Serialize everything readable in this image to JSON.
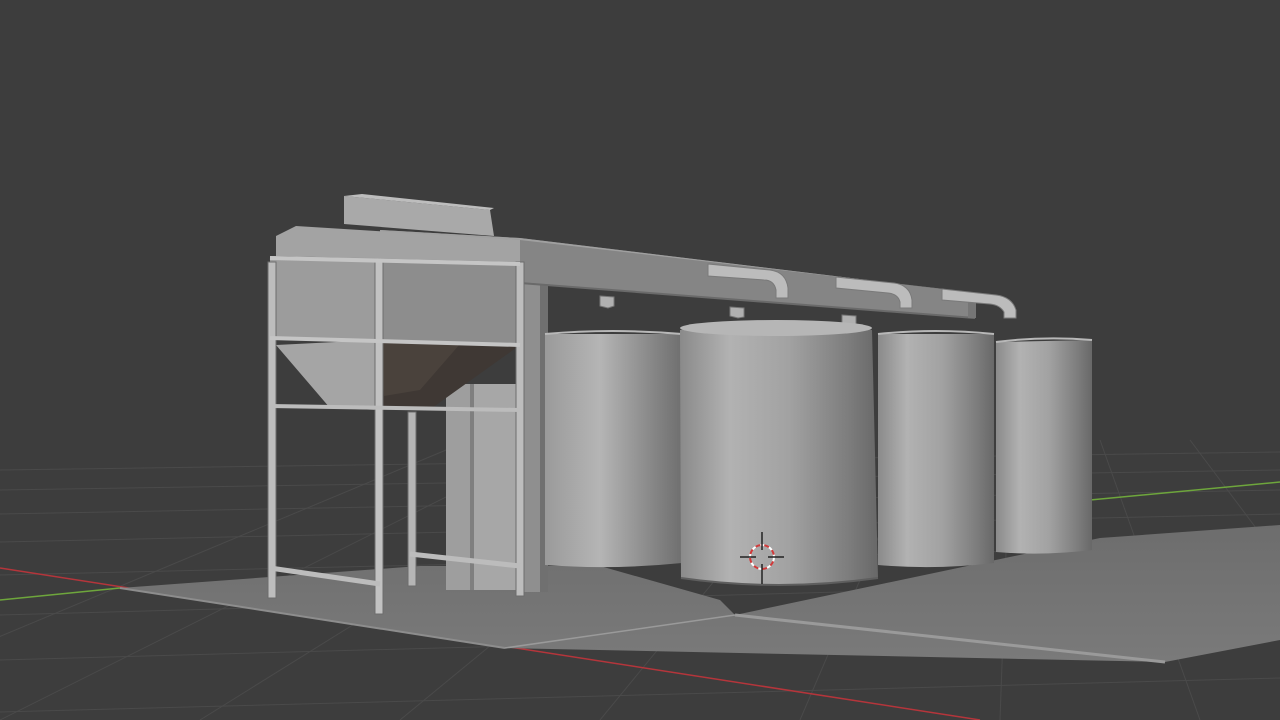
{
  "viewport": {
    "mode": "3d-viewport",
    "background_color": "#3d3d3d",
    "grid_color": "#4a4a4a",
    "x_axis_color": "#b5353b",
    "y_axis_color": "#6ea63c",
    "floor_color": "#777777",
    "object_color": "#9b9b9b"
  },
  "scene": {
    "objects": [
      {
        "name": "floor-plane"
      },
      {
        "name": "hopper-structure"
      },
      {
        "name": "conveyor-beam"
      },
      {
        "name": "downspout-pipes",
        "count": 3
      },
      {
        "name": "storage-tanks",
        "count": 4
      }
    ],
    "origin_marker": "orange-dot",
    "cursor": "3d-cursor"
  }
}
